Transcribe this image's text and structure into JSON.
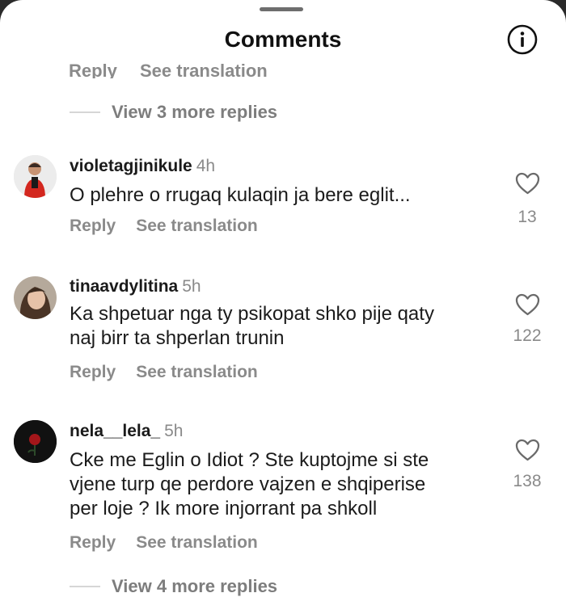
{
  "header": {
    "title": "Comments",
    "info_icon": "info-icon"
  },
  "previous_thread": {
    "reply_label": "Reply",
    "translate_label": "See translation",
    "view_more": "View 3 more replies"
  },
  "comments": [
    {
      "username": "violetagjinikule",
      "time": "4h",
      "text": [
        "O plehre o rrugaq kulaqin ja bere eglit..."
      ],
      "likes": "13",
      "reply_label": "Reply",
      "translate_label": "See translation",
      "avatar_icon": "kid-avatar"
    },
    {
      "username": "tinaavdylitina",
      "time": "5h",
      "text": [
        "Ka shpetuar nga ty psikopat shko pije qaty",
        "naj birr ta shperlan trunin"
      ],
      "likes": "122",
      "reply_label": "Reply",
      "translate_label": "See translation",
      "avatar_icon": "woman-avatar"
    },
    {
      "username": "nela__lela_",
      "time": "5h",
      "text": [
        "Cke me Eglin o Idiot ? Ste kuptojme si ste",
        "vjene turp qe perdore vajzen e shqiperise",
        "per loje ? Ik more injorrant pa  shkoll"
      ],
      "likes": "138",
      "reply_label": "Reply",
      "translate_label": "See translation",
      "avatar_icon": "rose-avatar",
      "view_more": "View 4 more replies"
    }
  ],
  "colors": {
    "text": "#1b1b1b",
    "muted": "#8a8a8a",
    "background": "#ffffff"
  }
}
